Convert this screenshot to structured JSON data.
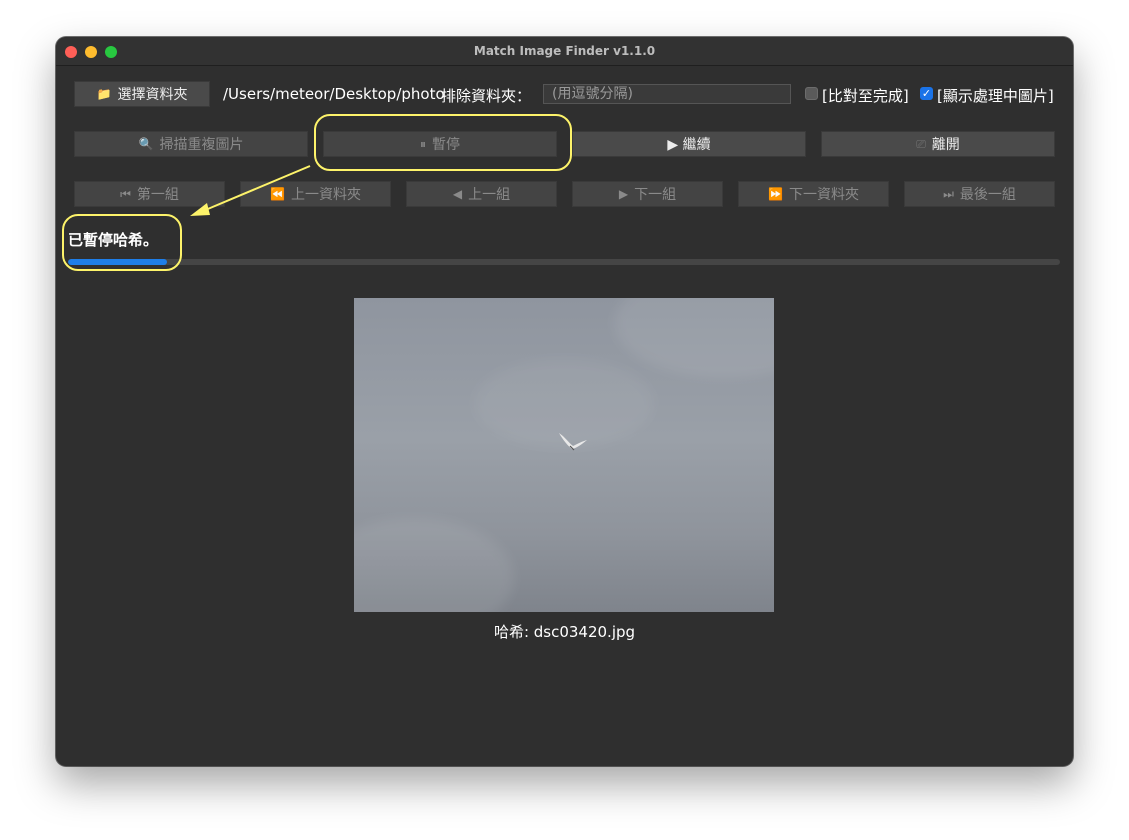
{
  "window": {
    "title": "Match Image Finder v1.1.0"
  },
  "toolbar": {
    "select_folder_label": "選擇資料夾",
    "folder_path": "/Users/meteor/Desktop/photo",
    "exclude_label": "排除資料夾：",
    "exclude_placeholder": "(用逗號分隔)",
    "compare_to_end_label": "[比對至完成]",
    "compare_to_end_checked": false,
    "show_processing_label": "[顯示處理中圖片]",
    "show_processing_checked": true
  },
  "actions": {
    "scan_label": "掃描重複圖片",
    "pause_label": "暫停",
    "resume_label": "▶ 繼續",
    "exit_label": "離開"
  },
  "navigation": {
    "first_group": "第一組",
    "prev_folder": "上一資料夾",
    "prev_group": "上一組",
    "next_group": "下一組",
    "next_folder": "下一資料夾",
    "last_group": "最後一組"
  },
  "status": {
    "message": "已暫停哈希。",
    "progress": 0.1
  },
  "preview": {
    "caption": "哈希: dsc03420.jpg"
  },
  "colors": {
    "accent": "#1e7ee8",
    "annotation": "#fdf36a",
    "window_bg": "#2f2f2f"
  },
  "icons": [
    "folder-icon",
    "magnifier-icon",
    "pause-icon",
    "play-icon",
    "exit-icon",
    "first-icon",
    "rewind-icon",
    "prev-icon",
    "next-icon",
    "forward-icon",
    "last-icon"
  ]
}
